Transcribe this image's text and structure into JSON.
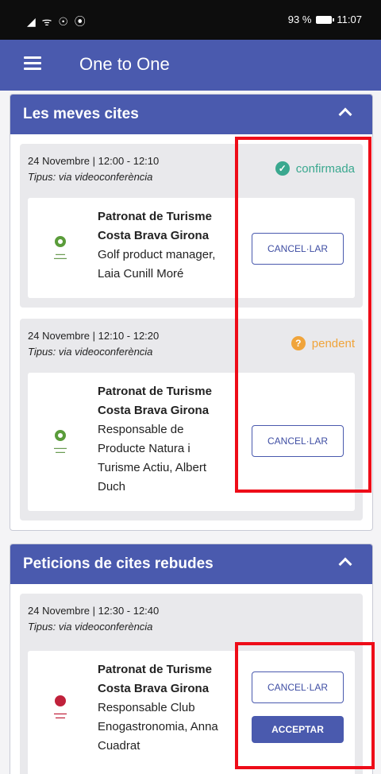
{
  "statusbar": {
    "left_icons": "◢ ᯤ ☉ ⦿",
    "battery": "93 %",
    "time": "11:07"
  },
  "appbar": {
    "title": "One to One"
  },
  "section_my": {
    "title": "Les meves cites",
    "appointments": [
      {
        "time": "24 Novembre | 12:00 - 12:10",
        "type": "Tipus: via videoconferència",
        "status": "confirmada",
        "org_line1": "Patronat de Turisme",
        "org_line2": "Costa Brava Girona",
        "role_lines": [
          "Golf product manager,",
          "Laia Cunill Moré"
        ],
        "cancel_label": "CANCEL·LAR"
      },
      {
        "time": "24 Novembre | 12:10 - 12:20",
        "type": "Tipus: via videoconferència",
        "status": "pendent",
        "org_line1": "Patronat de Turisme",
        "org_line2": "Costa Brava Girona",
        "role_lines": [
          "Responsable de",
          "Producte Natura i",
          "Turisme Actiu, Albert",
          "Duch"
        ],
        "cancel_label": "CANCEL·LAR"
      }
    ]
  },
  "section_requests": {
    "title": "Peticions de cites rebudes",
    "appointments": [
      {
        "time": "24 Novembre | 12:30 - 12:40",
        "type": "Tipus: via videoconferència",
        "org_line1": "Patronat de Turisme",
        "org_line2": "Costa Brava Girona",
        "role_lines": [
          "Responsable Club",
          "Enogastronomia, Anna",
          "Cuadrat"
        ],
        "cancel_label": "CANCEL·LAR",
        "accept_label": "ACCEPTAR"
      }
    ]
  },
  "colors": {
    "primary": "#4a5aae",
    "confirmed": "#3aa88f",
    "pending": "#f0a43b",
    "highlight": "#ee0c18"
  },
  "icons": {
    "menu": "hamburger-icon",
    "collapse": "chevron-up-icon",
    "confirmed": "check-circle-icon",
    "pending": "help-circle-icon"
  }
}
